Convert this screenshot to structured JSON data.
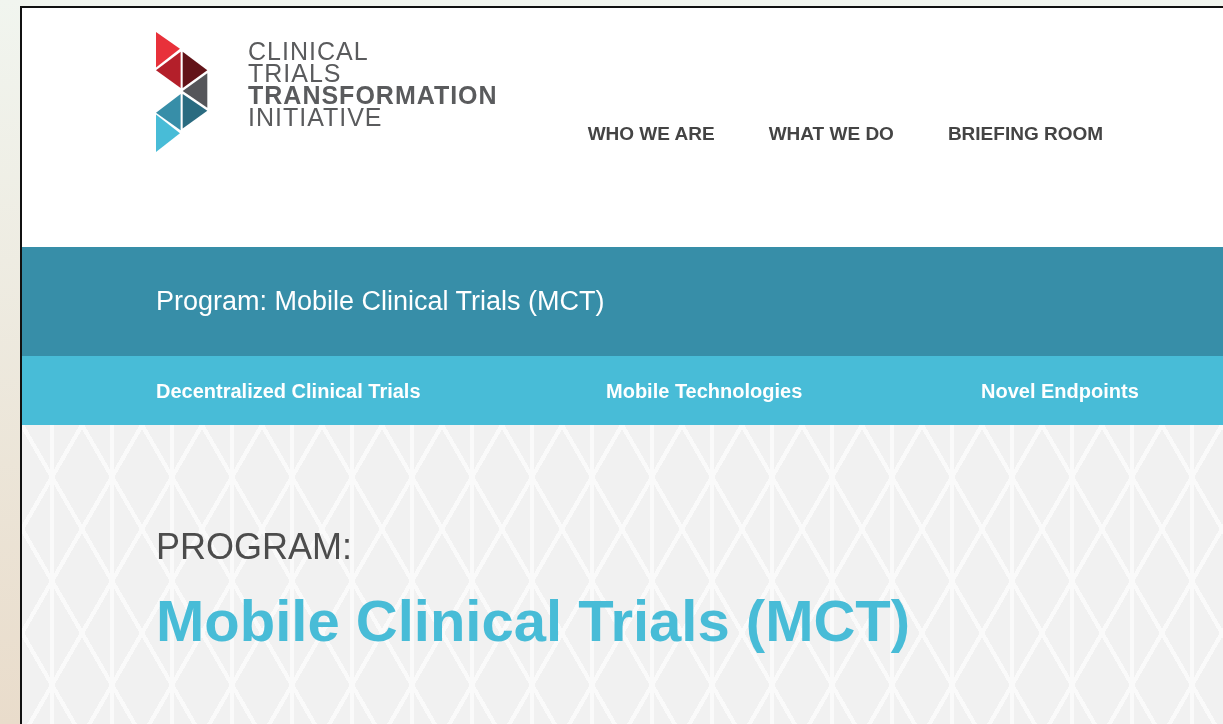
{
  "logo": {
    "lines": [
      {
        "text": "CLINICAL",
        "bold": false
      },
      {
        "text": "TRIALS",
        "bold": false
      },
      {
        "text": "TRANSFORMATION",
        "bold": true
      },
      {
        "text": "INITIATIVE",
        "bold": false
      }
    ]
  },
  "main_nav": [
    {
      "label": "WHO WE ARE"
    },
    {
      "label": "WHAT WE DO"
    },
    {
      "label": "BRIEFING ROOM"
    }
  ],
  "program_bar": {
    "title": "Program: Mobile Clinical Trials (MCT)"
  },
  "sub_nav": [
    {
      "label": "Decentralized Clinical Trials"
    },
    {
      "label": "Mobile Technologies"
    },
    {
      "label": "Novel Endpoints"
    }
  ],
  "hero": {
    "eyebrow": "PROGRAM:",
    "title": "Mobile Clinical Trials (MCT)"
  }
}
